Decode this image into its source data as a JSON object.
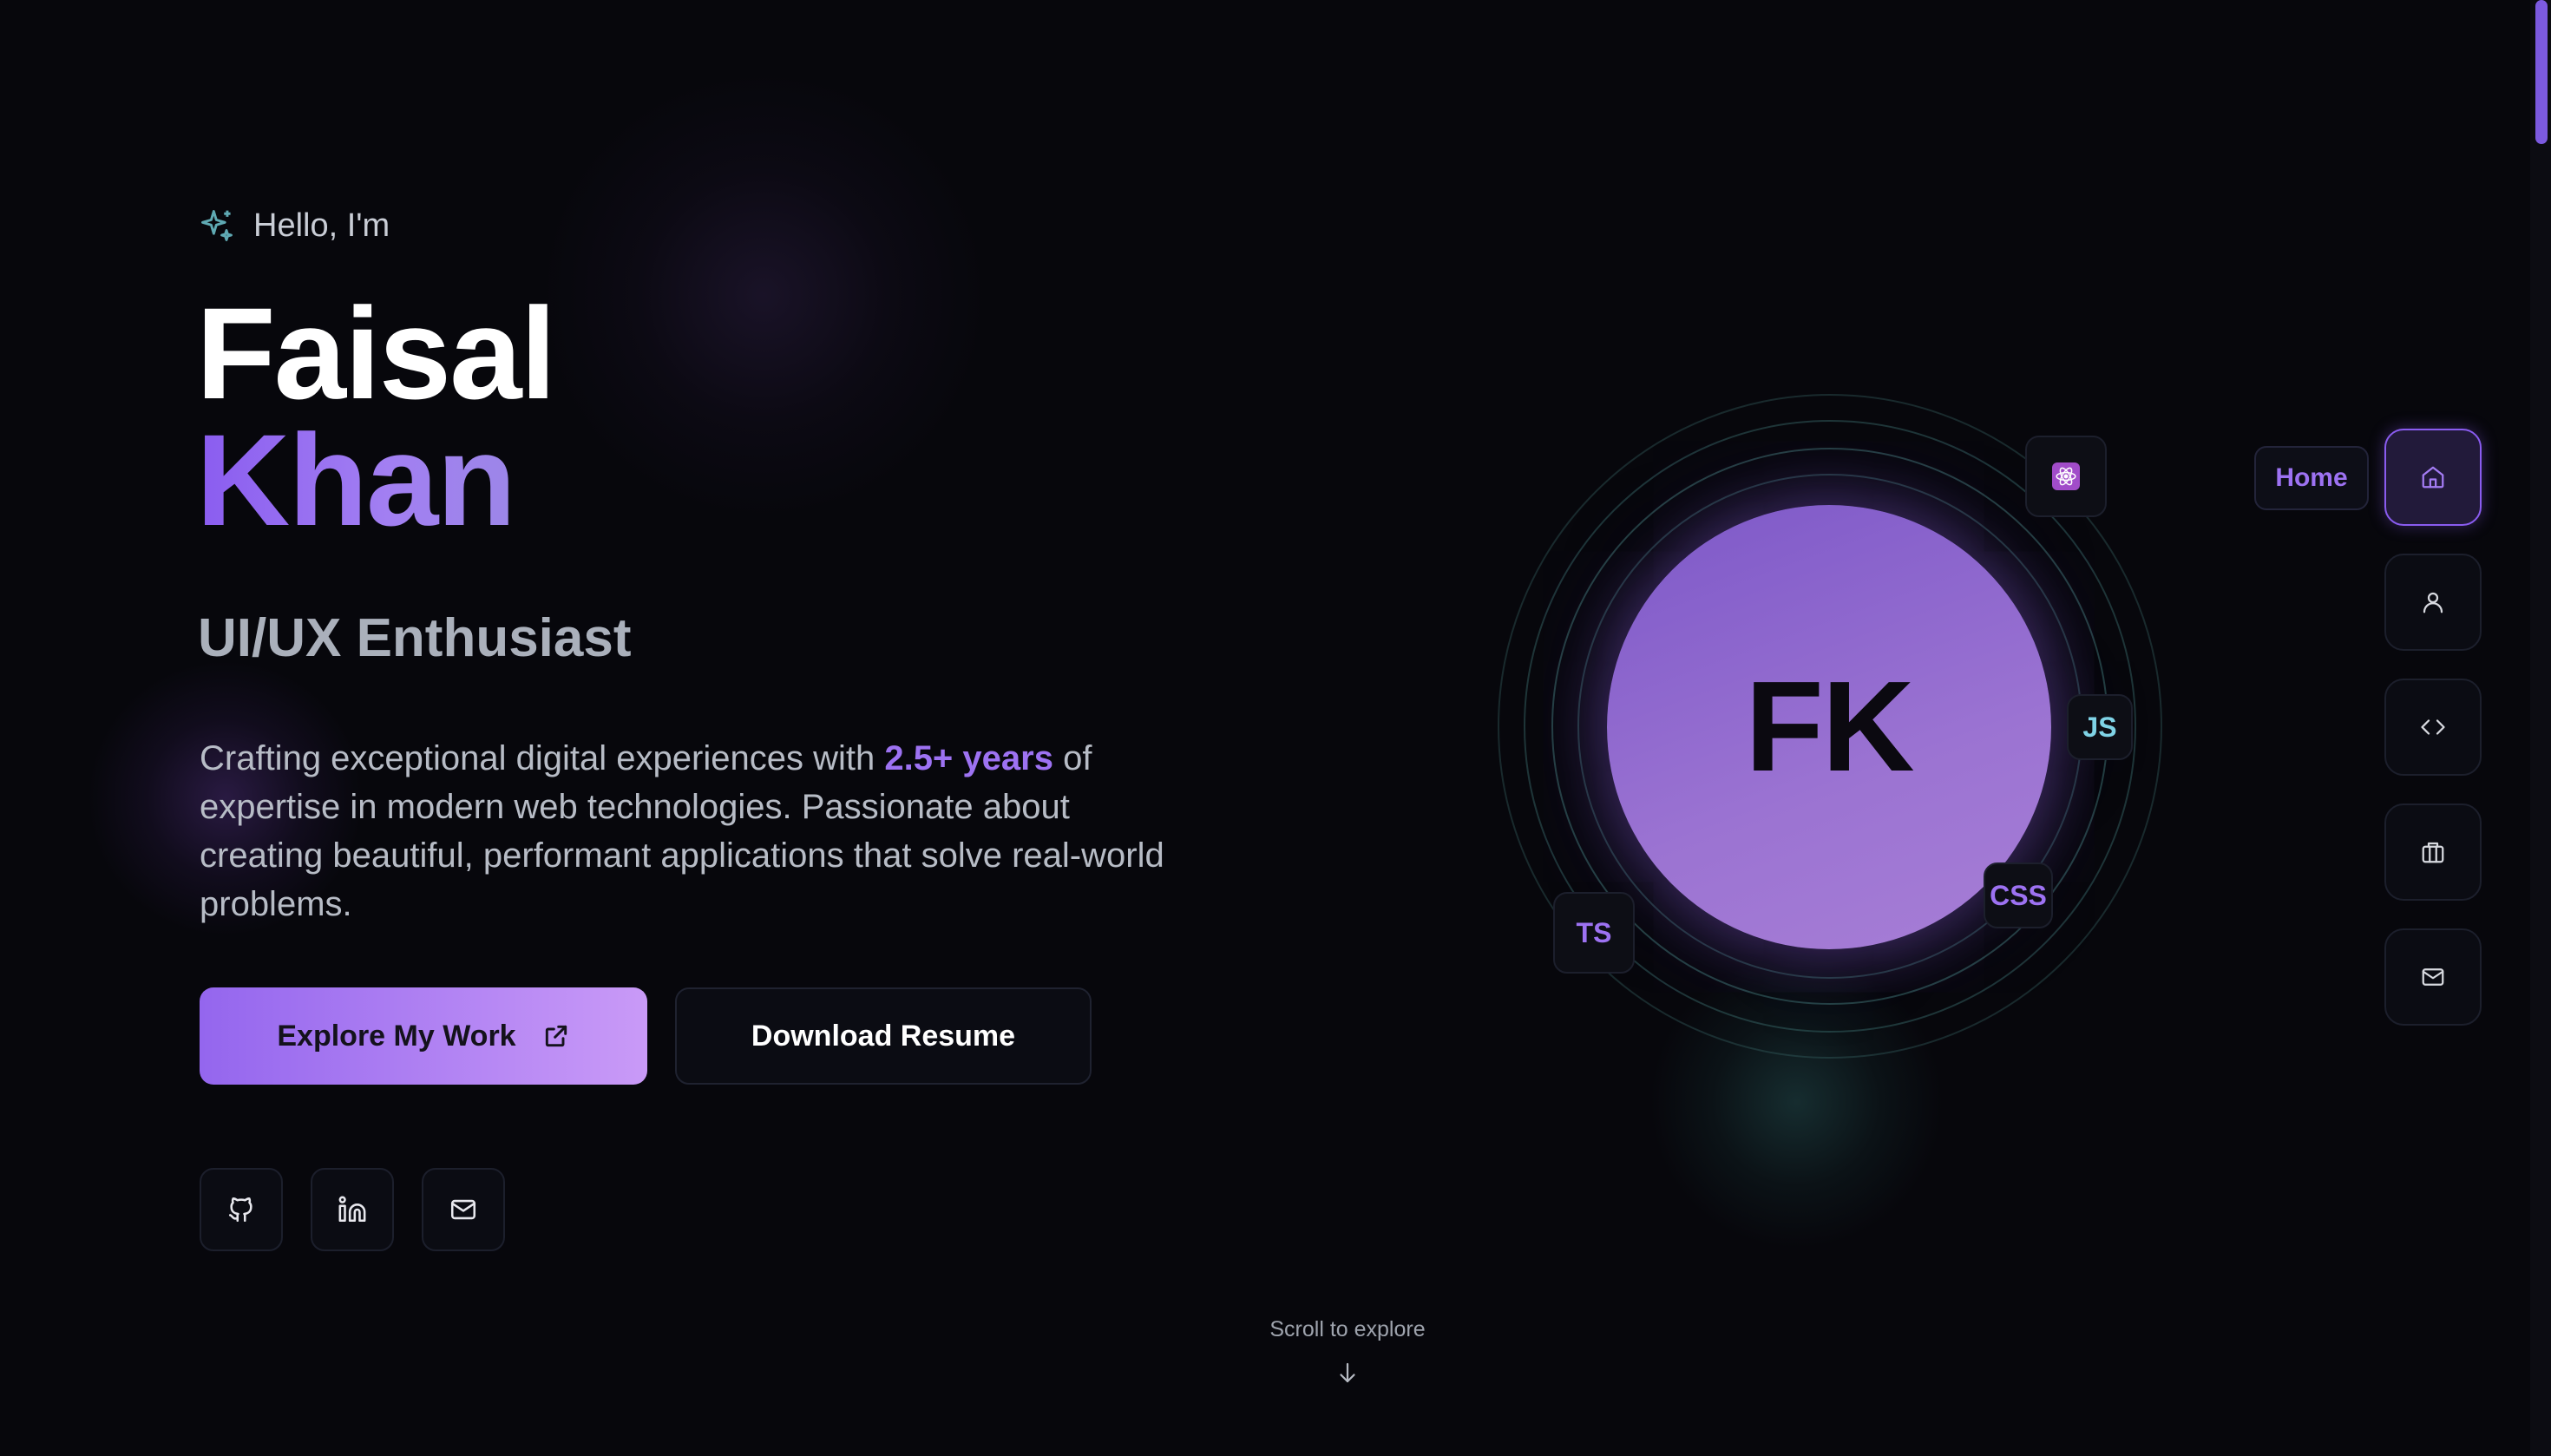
{
  "hero": {
    "greeting": "Hello, I'm",
    "first_name": "Faisal",
    "last_name": "Khan",
    "role": "UI/UX Enthusiast",
    "bio_before": "Crafting exceptional digital experiences with ",
    "bio_highlight": "2.5+ years",
    "bio_after": " of expertise in modern web technologies. Passionate about creating beautiful, performant applications that solve real-world problems.",
    "primary_button": "Explore My Work",
    "secondary_button": "Download Resume"
  },
  "social": [
    {
      "icon": "github-icon"
    },
    {
      "icon": "linkedin-icon"
    },
    {
      "icon": "mail-icon"
    }
  ],
  "scroll_hint": "Scroll to explore",
  "avatar": {
    "initials": "FK"
  },
  "tech_badges": {
    "react": "react-icon",
    "js": "JS",
    "css": "CSS",
    "ts": "TS"
  },
  "nav": {
    "active_tooltip": "Home",
    "items": [
      {
        "icon": "home-icon",
        "active": true
      },
      {
        "icon": "user-icon",
        "active": false
      },
      {
        "icon": "code-icon",
        "active": false
      },
      {
        "icon": "briefcase-icon",
        "active": false
      },
      {
        "icon": "mail-icon",
        "active": false
      }
    ]
  },
  "colors": {
    "background": "#07070c",
    "accent": "#9d72f2",
    "accent_gradient_start": "#9466ee",
    "accent_gradient_end": "#c99af7",
    "teal": "#3a8c8c",
    "js_color": "#7fd3e6",
    "css_color": "#9d72f2",
    "ts_color": "#9d72f2"
  }
}
